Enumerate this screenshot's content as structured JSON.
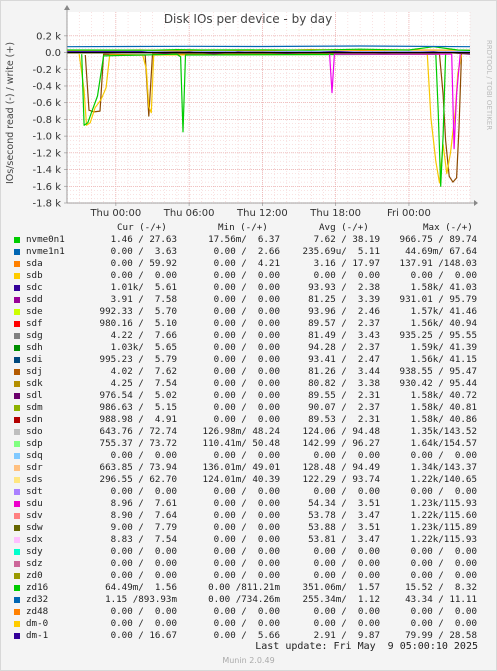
{
  "chart_data": {
    "type": "line",
    "title": "Disk IOs per device - by day",
    "ylabel": "IOs/second read (-) / write (+)",
    "side_label": "RRDTOOL / TOBI OETIKER",
    "ylim": [
      -1800,
      150
    ],
    "y_ticks": [
      {
        "value": 200,
        "label": "0.2 k"
      },
      {
        "value": 0,
        "label": "0.0"
      },
      {
        "value": -200,
        "label": "-0.2 k"
      },
      {
        "value": -400,
        "label": "-0.4 k"
      },
      {
        "value": -600,
        "label": "-0.6 k"
      },
      {
        "value": -800,
        "label": "-0.8 k"
      },
      {
        "value": -1000,
        "label": "-1.0 k"
      },
      {
        "value": -1200,
        "label": "-1.2 k"
      },
      {
        "value": -1400,
        "label": "-1.4 k"
      },
      {
        "value": -1600,
        "label": "-1.6 k"
      },
      {
        "value": -1800,
        "label": "-1.8 k"
      }
    ],
    "x_ticks": [
      {
        "hour": 0,
        "label": "Thu 00:00"
      },
      {
        "hour": 6,
        "label": "Thu 06:00"
      },
      {
        "hour": 12,
        "label": "Thu 12:00"
      },
      {
        "hour": 18,
        "label": "Thu 18:00"
      },
      {
        "hour": 24,
        "label": "Fri 00:00"
      }
    ],
    "xlim": [
      -4,
      29
    ],
    "series": [
      {
        "name": "sdj",
        "color": "#8c4a00",
        "points": [
          [
            -2.5,
            -30
          ],
          [
            -2.2,
            -690
          ],
          [
            -1.8,
            -710
          ],
          [
            -1.3,
            -700
          ],
          [
            -1,
            -20
          ],
          [
            2,
            -30
          ],
          [
            2.4,
            -30
          ],
          [
            2.7,
            -760
          ],
          [
            3,
            -20
          ],
          [
            26.5,
            -20
          ],
          [
            26.8,
            -500
          ],
          [
            27,
            -1050
          ],
          [
            27.3,
            -1480
          ],
          [
            27.6,
            -1550
          ],
          [
            27.9,
            -1500
          ],
          [
            28.1,
            -900
          ],
          [
            28.3,
            -20
          ]
        ]
      },
      {
        "name": "sdi",
        "color": "#f7c800",
        "points": [
          [
            -3,
            -20
          ],
          [
            -2.6,
            -450
          ],
          [
            -2.4,
            -870
          ],
          [
            -2.1,
            -840
          ],
          [
            -1.7,
            -660
          ],
          [
            -1.2,
            -560
          ],
          [
            -0.8,
            -420
          ],
          [
            -0.5,
            -30
          ],
          [
            2.2,
            -30
          ],
          [
            2.5,
            -200
          ],
          [
            2.7,
            -650
          ],
          [
            2.9,
            -720
          ],
          [
            3.1,
            -30
          ],
          [
            25.5,
            -20
          ],
          [
            25.8,
            -780
          ],
          [
            26.2,
            -1300
          ],
          [
            26.5,
            -1560
          ],
          [
            26.8,
            -1100
          ],
          [
            27.1,
            -1450
          ],
          [
            27.4,
            -1200
          ],
          [
            27.8,
            -700
          ],
          [
            28,
            -250
          ],
          [
            28.3,
            -30
          ]
        ]
      },
      {
        "name": "sdc",
        "color": "#00cc00",
        "points": [
          [
            -2.8,
            -20
          ],
          [
            -2.6,
            -870
          ],
          [
            -2.3,
            -840
          ],
          [
            -2,
            -720
          ],
          [
            -1.5,
            -520
          ],
          [
            -1,
            -40
          ],
          [
            5,
            -20
          ],
          [
            5.3,
            -50
          ],
          [
            5.5,
            -950
          ],
          [
            5.7,
            -30
          ],
          [
            26.2,
            -20
          ],
          [
            26.4,
            -700
          ],
          [
            26.6,
            -1600
          ],
          [
            26.8,
            -1000
          ],
          [
            27,
            -20
          ]
        ]
      },
      {
        "name": "sdo",
        "color": "#ee00ee",
        "points": [
          [
            17.5,
            -20
          ],
          [
            17.7,
            -480
          ],
          [
            17.9,
            -20
          ],
          [
            27.5,
            -20
          ],
          [
            27.7,
            -1150
          ],
          [
            27.9,
            -500
          ],
          [
            28.2,
            -20
          ]
        ]
      },
      {
        "name": "sdl",
        "color": "#6a006a",
        "points": [
          [
            -4,
            15
          ],
          [
            2,
            12
          ],
          [
            4,
            -12
          ],
          [
            6,
            10
          ],
          [
            8,
            -15
          ],
          [
            10,
            8
          ],
          [
            14,
            -10
          ],
          [
            18,
            12
          ],
          [
            22,
            -8
          ],
          [
            26,
            10
          ],
          [
            29,
            -20
          ]
        ]
      },
      {
        "name": "sda",
        "color": "#f7a600",
        "points": [
          [
            -4,
            25
          ],
          [
            2,
            30
          ],
          [
            5,
            20
          ],
          [
            8,
            28
          ],
          [
            12,
            22
          ],
          [
            16,
            35
          ],
          [
            20,
            25
          ],
          [
            24,
            30
          ],
          [
            29,
            28
          ]
        ]
      },
      {
        "name": "zd32",
        "color": "#3333ff",
        "points": [
          [
            -4,
            5
          ],
          [
            29,
            5
          ]
        ]
      },
      {
        "name": "nvme0n1",
        "color": "#00cc00",
        "points": [
          [
            -4,
            30
          ],
          [
            3,
            28
          ],
          [
            5,
            35
          ],
          [
            7,
            30
          ],
          [
            12,
            32
          ],
          [
            16,
            28
          ],
          [
            20,
            40
          ],
          [
            24,
            30
          ],
          [
            26,
            70
          ],
          [
            28,
            30
          ],
          [
            29,
            25
          ]
        ]
      },
      {
        "name": "sdw",
        "color": "#555500",
        "points": [
          [
            -4,
            -4
          ],
          [
            29,
            -4
          ]
        ]
      },
      {
        "name": "nvme1n1",
        "color": "#0066b3",
        "points": [
          [
            -4,
            70
          ],
          [
            6,
            75
          ],
          [
            12,
            72
          ],
          [
            20,
            78
          ],
          [
            29,
            70
          ]
        ]
      }
    ]
  },
  "legend": {
    "headers": {
      "cur": "Cur (-/+)",
      "min": "Min (-/+)",
      "avg": "Avg (-/+)",
      "max": "Max (-/+)"
    },
    "rows": [
      {
        "name": "nvme0n1",
        "color": "#00cc00",
        "cur": "1.46 / 27.63",
        "min": "17.56m/  6.37",
        "avg": "7.62 / 38.19",
        "max": "966.75 / 89.74"
      },
      {
        "name": "nvme1n1",
        "color": "#0066b3",
        "cur": "0.00 /  3.63",
        "min": "0.00 /  2.66",
        "avg": "235.69u/  5.11",
        "max": "44.69m/ 67.64"
      },
      {
        "name": "sda",
        "color": "#ff8000",
        "cur": "0.00 / 59.92",
        "min": "0.00 /  4.21",
        "avg": "3.16 / 17.97",
        "max": "137.91 /148.03"
      },
      {
        "name": "sdb",
        "color": "#ffcc00",
        "cur": "0.00 /  0.00",
        "min": "0.00 /  0.00",
        "avg": "0.00 /  0.00",
        "max": "0.00 /  0.00"
      },
      {
        "name": "sdc",
        "color": "#330099",
        "cur": "1.01k/  5.61",
        "min": "0.00 /  0.00",
        "avg": "93.93 /  2.38",
        "max": "1.58k/ 41.03"
      },
      {
        "name": "sdd",
        "color": "#990099",
        "cur": "3.91 /  7.58",
        "min": "0.00 /  0.00",
        "avg": "81.25 /  3.39",
        "max": "931.01 / 95.79"
      },
      {
        "name": "sde",
        "color": "#ccff00",
        "cur": "992.33 /  5.70",
        "min": "0.00 /  0.00",
        "avg": "93.96 /  2.46",
        "max": "1.57k/ 41.46"
      },
      {
        "name": "sdf",
        "color": "#ff0000",
        "cur": "980.16 /  5.10",
        "min": "0.00 /  0.00",
        "avg": "89.57 /  2.37",
        "max": "1.56k/ 40.94"
      },
      {
        "name": "sdg",
        "color": "#808080",
        "cur": "4.22 /  7.66",
        "min": "0.00 /  0.00",
        "avg": "81.49 /  3.43",
        "max": "935.25 / 95.55"
      },
      {
        "name": "sdh",
        "color": "#008f00",
        "cur": "1.03k/  5.65",
        "min": "0.00 /  0.00",
        "avg": "94.28 /  2.37",
        "max": "1.59k/ 41.39"
      },
      {
        "name": "sdi",
        "color": "#00487d",
        "cur": "995.23 /  5.79",
        "min": "0.00 /  0.00",
        "avg": "93.41 /  2.47",
        "max": "1.56k/ 41.15"
      },
      {
        "name": "sdj",
        "color": "#b35a00",
        "cur": "4.02 /  7.62",
        "min": "0.00 /  0.00",
        "avg": "81.26 /  3.44",
        "max": "938.55 / 95.47"
      },
      {
        "name": "sdk",
        "color": "#b38f00",
        "cur": "4.25 /  7.54",
        "min": "0.00 /  0.00",
        "avg": "80.82 /  3.38",
        "max": "930.42 / 95.44"
      },
      {
        "name": "sdl",
        "color": "#6b006b",
        "cur": "976.54 /  5.02",
        "min": "0.00 /  0.00",
        "avg": "89.55 /  2.31",
        "max": "1.58k/ 40.72"
      },
      {
        "name": "sdm",
        "color": "#8fb300",
        "cur": "986.63 /  5.15",
        "min": "0.00 /  0.00",
        "avg": "90.07 /  2.37",
        "max": "1.58k/ 40.81"
      },
      {
        "name": "sdn",
        "color": "#b30000",
        "cur": "988.98 /  4.91",
        "min": "0.00 /  0.00",
        "avg": "89.53 /  2.31",
        "max": "1.58k/ 40.86"
      },
      {
        "name": "sdo",
        "color": "#bebebe",
        "cur": "643.76 / 72.74",
        "min": "126.98m/ 48.24",
        "avg": "124.06 / 94.48",
        "max": "1.35k/143.52"
      },
      {
        "name": "sdp",
        "color": "#80ff80",
        "cur": "755.37 / 73.72",
        "min": "110.41m/ 50.48",
        "avg": "142.99 / 96.27",
        "max": "1.64k/154.57"
      },
      {
        "name": "sdq",
        "color": "#80c9ff",
        "cur": "0.00 /  0.00",
        "min": "0.00 /  0.00",
        "avg": "0.00 /  0.00",
        "max": "0.00 /  0.00"
      },
      {
        "name": "sdr",
        "color": "#ffc080",
        "cur": "663.85 / 73.94",
        "min": "136.01m/ 49.01",
        "avg": "128.48 / 94.49",
        "max": "1.34k/143.37"
      },
      {
        "name": "sds",
        "color": "#ffe680",
        "cur": "296.55 / 62.70",
        "min": "124.01m/ 40.39",
        "avg": "122.29 / 93.74",
        "max": "1.22k/140.65"
      },
      {
        "name": "sdt",
        "color": "#aa80ff",
        "cur": "0.00 /  0.00",
        "min": "0.00 /  0.00",
        "avg": "0.00 /  0.00",
        "max": "0.00 /  0.00"
      },
      {
        "name": "sdu",
        "color": "#ee00cc",
        "cur": "8.96 /  7.61",
        "min": "0.00 /  0.00",
        "avg": "54.34 /  3.51",
        "max": "1.23k/115.93"
      },
      {
        "name": "sdv",
        "color": "#ff8080",
        "cur": "8.90 /  7.64",
        "min": "0.00 /  0.00",
        "avg": "53.78 /  3.47",
        "max": "1.22k/115.60"
      },
      {
        "name": "sdw",
        "color": "#666600",
        "cur": "9.00 /  7.79",
        "min": "0.00 /  0.00",
        "avg": "53.88 /  3.51",
        "max": "1.23k/115.89"
      },
      {
        "name": "sdx",
        "color": "#ffbfff",
        "cur": "8.83 /  7.54",
        "min": "0.00 /  0.00",
        "avg": "53.81 /  3.47",
        "max": "1.22k/115.93"
      },
      {
        "name": "sdy",
        "color": "#00ffcc",
        "cur": "0.00 /  0.00",
        "min": "0.00 /  0.00",
        "avg": "0.00 /  0.00",
        "max": "0.00 /  0.00"
      },
      {
        "name": "sdz",
        "color": "#cc6699",
        "cur": "0.00 /  0.00",
        "min": "0.00 /  0.00",
        "avg": "0.00 /  0.00",
        "max": "0.00 /  0.00"
      },
      {
        "name": "zd0",
        "color": "#999900",
        "cur": "0.00 /  0.00",
        "min": "0.00 /  0.00",
        "avg": "0.00 /  0.00",
        "max": "0.00 /  0.00"
      },
      {
        "name": "zd16",
        "color": "#00cc00",
        "cur": "64.49m/  1.56",
        "min": "0.00 /811.21m",
        "avg": "351.06m/  1.57",
        "max": "15.52 /  8.32"
      },
      {
        "name": "zd32",
        "color": "#0066b3",
        "cur": "1.15 /893.93m",
        "min": "0.00 /734.26m",
        "avg": "255.34m/  1.12",
        "max": "43.34 / 11.11"
      },
      {
        "name": "zd48",
        "color": "#ff8000",
        "cur": "0.00 /  0.00",
        "min": "0.00 /  0.00",
        "avg": "0.00 /  0.00",
        "max": "0.00 /  0.00"
      },
      {
        "name": "dm-0",
        "color": "#ffcc00",
        "cur": "0.00 /  0.00",
        "min": "0.00 /  0.00",
        "avg": "0.00 /  0.00",
        "max": "0.00 /  0.00"
      },
      {
        "name": "dm-1",
        "color": "#330099",
        "cur": "0.00 / 16.67",
        "min": "0.00 /  5.66",
        "avg": "2.91 /  9.87",
        "max": "79.99 / 28.58"
      }
    ]
  },
  "footer": {
    "last_update": "Last update: Fri May  9 05:00:10 2025",
    "version": "Munin 2.0.49"
  }
}
